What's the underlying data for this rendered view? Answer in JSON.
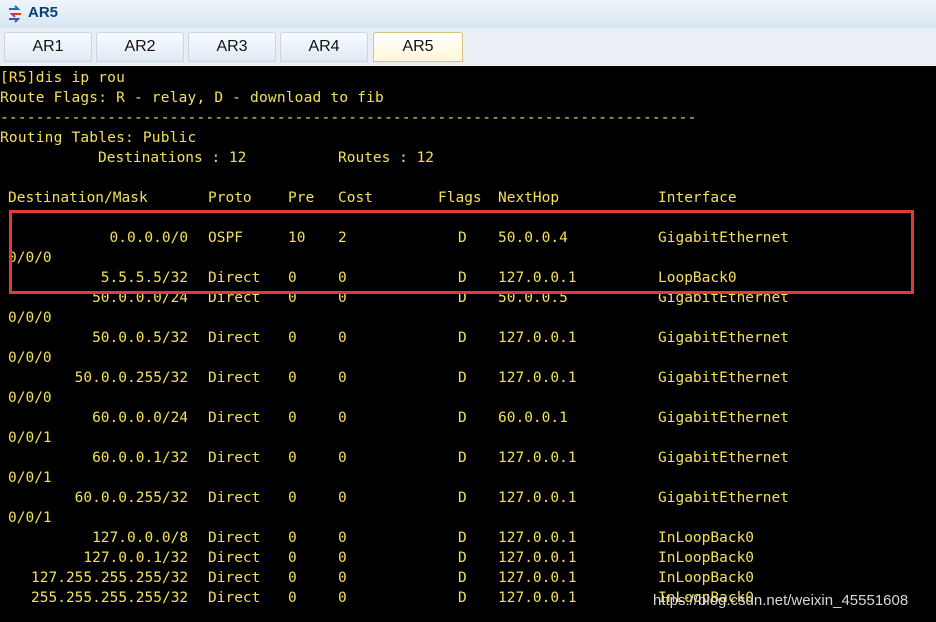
{
  "window": {
    "title": "AR5"
  },
  "tabs": [
    {
      "label": "AR1",
      "active": false
    },
    {
      "label": "AR2",
      "active": false
    },
    {
      "label": "AR3",
      "active": false
    },
    {
      "label": "AR4",
      "active": false
    },
    {
      "label": "AR5",
      "active": true
    }
  ],
  "console": {
    "command": "[R5]dis ip rou",
    "flags_line": "Route Flags: R - relay, D - download to fib",
    "separator": "------------------------------------------------------------------------------",
    "table_title": "Routing Tables: Public",
    "destinations_label": "Destinations : 12",
    "routes_label": "Routes : 12",
    "headers": {
      "dest": "Destination/Mask",
      "proto": "Proto",
      "pre": "Pre",
      "cost": "Cost",
      "flags": "Flags",
      "nexthop": "NextHop",
      "iface": "Interface"
    },
    "routes": [
      {
        "dest": "0.0.0.0/0",
        "proto": "OSPF",
        "pre": "10",
        "cost": "2",
        "flags": "D",
        "nexthop": "50.0.0.4",
        "iface": "GigabitEthernet",
        "cont": "0/0/0"
      },
      {
        "dest": "5.5.5.5/32",
        "proto": "Direct",
        "pre": "0",
        "cost": "0",
        "flags": "D",
        "nexthop": "127.0.0.1",
        "iface": "LoopBack0",
        "cont": ""
      },
      {
        "dest": "50.0.0.0/24",
        "proto": "Direct",
        "pre": "0",
        "cost": "0",
        "flags": "D",
        "nexthop": "50.0.0.5",
        "iface": "GigabitEthernet",
        "cont": "0/0/0"
      },
      {
        "dest": "50.0.0.5/32",
        "proto": "Direct",
        "pre": "0",
        "cost": "0",
        "flags": "D",
        "nexthop": "127.0.0.1",
        "iface": "GigabitEthernet",
        "cont": "0/0/0"
      },
      {
        "dest": "50.0.0.255/32",
        "proto": "Direct",
        "pre": "0",
        "cost": "0",
        "flags": "D",
        "nexthop": "127.0.0.1",
        "iface": "GigabitEthernet",
        "cont": "0/0/0"
      },
      {
        "dest": "60.0.0.0/24",
        "proto": "Direct",
        "pre": "0",
        "cost": "0",
        "flags": "D",
        "nexthop": "60.0.0.1",
        "iface": "GigabitEthernet",
        "cont": "0/0/1"
      },
      {
        "dest": "60.0.0.1/32",
        "proto": "Direct",
        "pre": "0",
        "cost": "0",
        "flags": "D",
        "nexthop": "127.0.0.1",
        "iface": "GigabitEthernet",
        "cont": "0/0/1"
      },
      {
        "dest": "60.0.0.255/32",
        "proto": "Direct",
        "pre": "0",
        "cost": "0",
        "flags": "D",
        "nexthop": "127.0.0.1",
        "iface": "GigabitEthernet",
        "cont": "0/0/1"
      },
      {
        "dest": "127.0.0.0/8",
        "proto": "Direct",
        "pre": "0",
        "cost": "0",
        "flags": "D",
        "nexthop": "127.0.0.1",
        "iface": "InLoopBack0",
        "cont": ""
      },
      {
        "dest": "127.0.0.1/32",
        "proto": "Direct",
        "pre": "0",
        "cost": "0",
        "flags": "D",
        "nexthop": "127.0.0.1",
        "iface": "InLoopBack0",
        "cont": ""
      },
      {
        "dest": "127.255.255.255/32",
        "proto": "Direct",
        "pre": "0",
        "cost": "0",
        "flags": "D",
        "nexthop": "127.0.0.1",
        "iface": "InLoopBack0",
        "cont": ""
      },
      {
        "dest": "255.255.255.255/32",
        "proto": "Direct",
        "pre": "0",
        "cost": "0",
        "flags": "D",
        "nexthop": "127.0.0.1",
        "iface": "InLoopBack0",
        "cont": ""
      }
    ]
  },
  "watermark": "https://blog.csdn.net/weixin_45551608",
  "colors": {
    "console_bg": "#000000",
    "console_text": "#f2e05a",
    "highlight": "#e03a3a"
  }
}
